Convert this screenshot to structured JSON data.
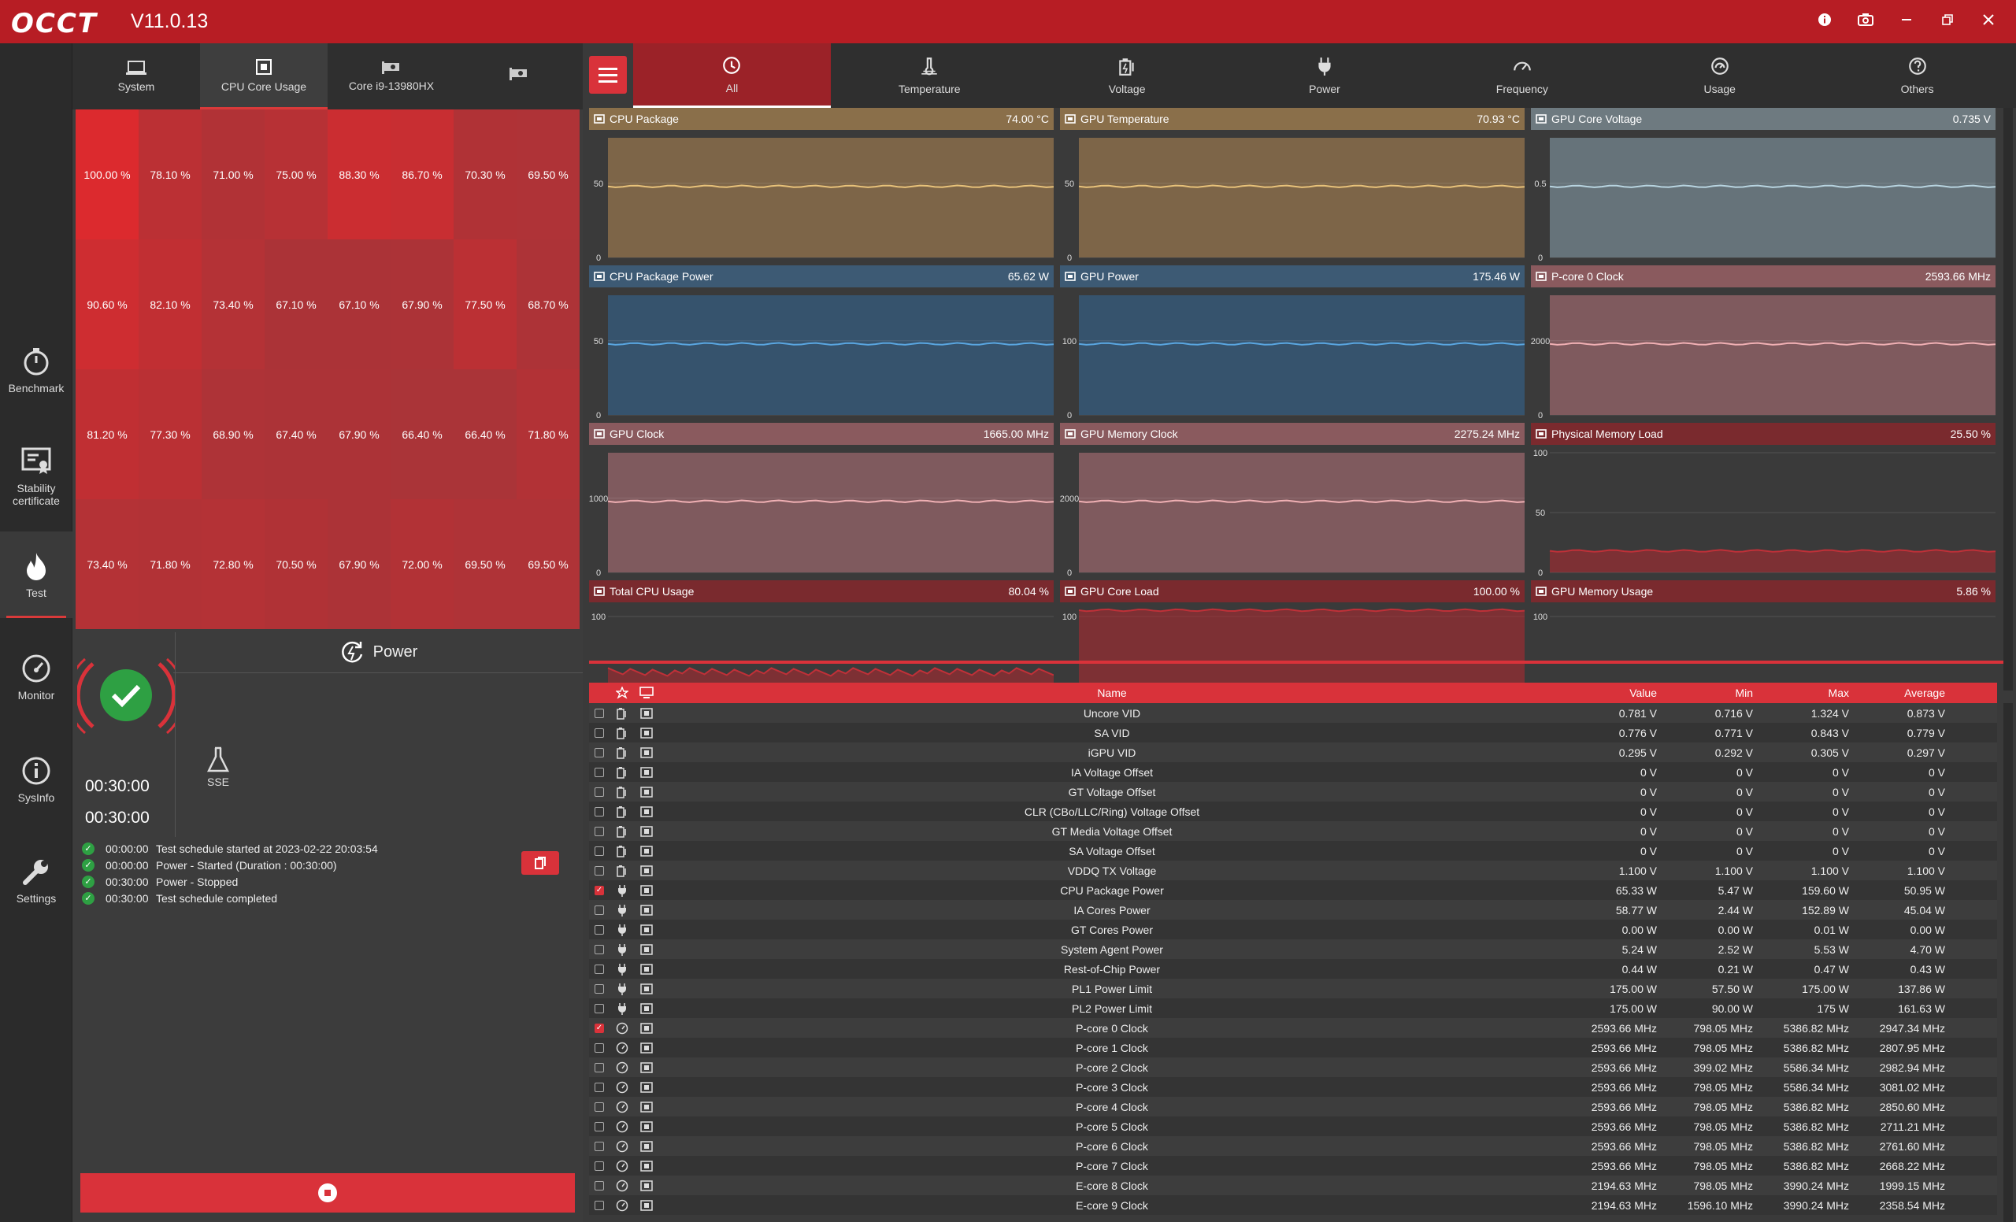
{
  "app": {
    "logo": "OCCT",
    "version": "V11.0.13"
  },
  "window_buttons": [
    "info-icon",
    "camera-icon",
    "minimize-icon",
    "restore-icon",
    "close-icon"
  ],
  "sidebar": [
    {
      "label": "Benchmark",
      "icon": "stopwatch-icon"
    },
    {
      "label": "Stability certificate",
      "icon": "certificate-icon"
    },
    {
      "label": "Test",
      "icon": "flame-icon",
      "active": true
    },
    {
      "label": "Monitor",
      "icon": "gauge-icon"
    },
    {
      "label": "SysInfo",
      "icon": "info-icon"
    },
    {
      "label": "Settings",
      "icon": "wrench-icon"
    }
  ],
  "left_tabs": [
    {
      "label": "System",
      "active": false
    },
    {
      "label": "CPU Core Usage",
      "active": true
    },
    {
      "label": "Core i9-13980HX",
      "active": false
    },
    {
      "label": "",
      "active": false
    }
  ],
  "core_usage": [
    "100.00 %",
    "78.10 %",
    "71.00 %",
    "75.00 %",
    "88.30 %",
    "86.70 %",
    "70.30 %",
    "69.50 %",
    "90.60 %",
    "82.10 %",
    "73.40 %",
    "67.10 %",
    "67.10 %",
    "67.90 %",
    "77.50 %",
    "68.70 %",
    "81.20 %",
    "77.30 %",
    "68.90 %",
    "67.40 %",
    "67.90 %",
    "66.40 %",
    "66.40 %",
    "71.80 %",
    "73.40 %",
    "71.80 %",
    "72.80 %",
    "70.50 %",
    "67.90 %",
    "72.00 %",
    "69.50 %",
    "69.50 %"
  ],
  "test": {
    "name": "Power",
    "elapsed": "00:30:00",
    "duration": "00:30:00",
    "mode": "SSE",
    "status": "completed"
  },
  "log": [
    {
      "time": "00:00:00",
      "text": "Test schedule started at 2023-02-22 20:03:54"
    },
    {
      "time": "00:00:00",
      "text": "Power - Started (Duration : 00:30:00)"
    },
    {
      "time": "00:30:00",
      "text": "Power - Stopped"
    },
    {
      "time": "00:30:00",
      "text": "Test schedule completed"
    }
  ],
  "right_tabs": [
    {
      "label": "All",
      "icon": "clock-icon",
      "active": true
    },
    {
      "label": "Temperature",
      "icon": "temperature-icon"
    },
    {
      "label": "Voltage",
      "icon": "battery-icon"
    },
    {
      "label": "Power",
      "icon": "plug-icon"
    },
    {
      "label": "Frequency",
      "icon": "speedometer-icon"
    },
    {
      "label": "Usage",
      "icon": "usage-gauge-icon"
    },
    {
      "label": "Others",
      "icon": "question-icon"
    }
  ],
  "charts": [
    {
      "title": "CPU Package",
      "value": "74.00 °C",
      "ticks": [
        "50",
        "0"
      ],
      "level": 0.66,
      "hdr": "#8a6f4a",
      "bg": "#7d6548",
      "line": "#e8c27a"
    },
    {
      "title": "GPU Temperature",
      "value": "70.93 °C",
      "ticks": [
        "50",
        "0"
      ],
      "level": 0.66,
      "hdr": "#8a6f4a",
      "bg": "#7d6548",
      "line": "#e8c27a"
    },
    {
      "title": "GPU Core Voltage",
      "value": "0.735 V",
      "ticks": [
        "0.5",
        "0"
      ],
      "level": 0.66,
      "hdr": "#6e7a80",
      "bg": "#66737a",
      "line": "#b8d4e0"
    },
    {
      "title": "CPU Package Power",
      "value": "65.62 W",
      "ticks": [
        "50",
        "0"
      ],
      "level": 0.66,
      "hdr": "#3d5a74",
      "bg": "#36536d",
      "line": "#5aa6e0"
    },
    {
      "title": "GPU Power",
      "value": "175.46 W",
      "ticks": [
        "100",
        "0"
      ],
      "level": 0.66,
      "hdr": "#3d5a74",
      "bg": "#36536d",
      "line": "#5aa6e0"
    },
    {
      "title": "P-core 0 Clock",
      "value": "2593.66 MHz",
      "ticks": [
        "2000",
        "0"
      ],
      "level": 0.66,
      "hdr": "#8a5a5e",
      "bg": "#7f5a5e",
      "line": "#f0b0b4"
    },
    {
      "title": "GPU Clock",
      "value": "1665.00 MHz",
      "ticks": [
        "1000",
        "0"
      ],
      "level": 0.66,
      "hdr": "#8a5a5e",
      "bg": "#7f5a5e",
      "line": "#f0b0b4"
    },
    {
      "title": "GPU Memory Clock",
      "value": "2275.24 MHz",
      "ticks": [
        "2000",
        "0"
      ],
      "level": 0.66,
      "hdr": "#8a5a5e",
      "bg": "#7f5a5e",
      "line": "#f0b0b4"
    },
    {
      "title": "Physical Memory Load",
      "value": "25.50 %",
      "ticks": [
        "100",
        "50",
        "0"
      ],
      "level": 0.2,
      "hdr": "#7a2a2e",
      "bg": "#3a3a3a",
      "line": "#c03038"
    },
    {
      "title": "Total CPU Usage",
      "value": "80.04 %",
      "ticks": [
        "100"
      ],
      "level": 0.3,
      "hdr": "#7a2a2e",
      "bg": "#3a3a3a",
      "line": "#c03038"
    },
    {
      "title": "GPU Core Load",
      "value": "100.00 %",
      "ticks": [
        "100"
      ],
      "level": 1.0,
      "hdr": "#7a2a2e",
      "bg": "#3a3a3a",
      "line": "#c03038"
    },
    {
      "title": "GPU Memory Usage",
      "value": "5.86 %",
      "ticks": [
        "100"
      ],
      "level": 0.06,
      "hdr": "#7a2a2e",
      "bg": "#3a3a3a",
      "line": "#c03038"
    }
  ],
  "table": {
    "headers": {
      "name": "Name",
      "value": "Value",
      "min": "Min",
      "max": "Max",
      "average": "Average"
    },
    "rows": [
      {
        "type": "voltage",
        "checked": false,
        "name": "Uncore VID",
        "value": "0.781 V",
        "min": "0.716 V",
        "max": "1.324 V",
        "avg": "0.873 V"
      },
      {
        "type": "voltage",
        "checked": false,
        "name": "SA VID",
        "value": "0.776 V",
        "min": "0.771 V",
        "max": "0.843 V",
        "avg": "0.779 V"
      },
      {
        "type": "voltage",
        "checked": false,
        "name": "iGPU VID",
        "value": "0.295 V",
        "min": "0.292 V",
        "max": "0.305 V",
        "avg": "0.297 V"
      },
      {
        "type": "voltage",
        "checked": false,
        "name": "IA Voltage Offset",
        "value": "0 V",
        "min": "0 V",
        "max": "0 V",
        "avg": "0 V"
      },
      {
        "type": "voltage",
        "checked": false,
        "name": "GT Voltage Offset",
        "value": "0 V",
        "min": "0 V",
        "max": "0 V",
        "avg": "0 V"
      },
      {
        "type": "voltage",
        "checked": false,
        "name": "CLR (CBo/LLC/Ring) Voltage Offset",
        "value": "0 V",
        "min": "0 V",
        "max": "0 V",
        "avg": "0 V"
      },
      {
        "type": "voltage",
        "checked": false,
        "name": "GT Media Voltage Offset",
        "value": "0 V",
        "min": "0 V",
        "max": "0 V",
        "avg": "0 V"
      },
      {
        "type": "voltage",
        "checked": false,
        "name": "SA Voltage Offset",
        "value": "0 V",
        "min": "0 V",
        "max": "0 V",
        "avg": "0 V"
      },
      {
        "type": "voltage",
        "checked": false,
        "name": "VDDQ TX Voltage",
        "value": "1.100 V",
        "min": "1.100 V",
        "max": "1.100 V",
        "avg": "1.100 V"
      },
      {
        "type": "power",
        "checked": true,
        "name": "CPU Package Power",
        "value": "65.33 W",
        "min": "5.47 W",
        "max": "159.60 W",
        "avg": "50.95 W"
      },
      {
        "type": "power",
        "checked": false,
        "name": "IA Cores Power",
        "value": "58.77 W",
        "min": "2.44 W",
        "max": "152.89 W",
        "avg": "45.04 W"
      },
      {
        "type": "power",
        "checked": false,
        "name": "GT Cores Power",
        "value": "0.00 W",
        "min": "0.00 W",
        "max": "0.01 W",
        "avg": "0.00 W"
      },
      {
        "type": "power",
        "checked": false,
        "name": "System Agent Power",
        "value": "5.24 W",
        "min": "2.52 W",
        "max": "5.53 W",
        "avg": "4.70 W"
      },
      {
        "type": "power",
        "checked": false,
        "name": "Rest-of-Chip Power",
        "value": "0.44 W",
        "min": "0.21 W",
        "max": "0.47 W",
        "avg": "0.43 W"
      },
      {
        "type": "power",
        "checked": false,
        "name": "PL1 Power Limit",
        "value": "175.00 W",
        "min": "57.50 W",
        "max": "175.00 W",
        "avg": "137.86 W"
      },
      {
        "type": "power",
        "checked": false,
        "name": "PL2 Power Limit",
        "value": "175.00 W",
        "min": "90.00 W",
        "max": "175 W",
        "avg": "161.63 W"
      },
      {
        "type": "freq",
        "checked": true,
        "name": "P-core 0 Clock",
        "value": "2593.66 MHz",
        "min": "798.05 MHz",
        "max": "5386.82 MHz",
        "avg": "2947.34 MHz"
      },
      {
        "type": "freq",
        "checked": false,
        "name": "P-core 1 Clock",
        "value": "2593.66 MHz",
        "min": "798.05 MHz",
        "max": "5386.82 MHz",
        "avg": "2807.95 MHz"
      },
      {
        "type": "freq",
        "checked": false,
        "name": "P-core 2 Clock",
        "value": "2593.66 MHz",
        "min": "399.02 MHz",
        "max": "5586.34 MHz",
        "avg": "2982.94 MHz"
      },
      {
        "type": "freq",
        "checked": false,
        "name": "P-core 3 Clock",
        "value": "2593.66 MHz",
        "min": "798.05 MHz",
        "max": "5586.34 MHz",
        "avg": "3081.02 MHz"
      },
      {
        "type": "freq",
        "checked": false,
        "name": "P-core 4 Clock",
        "value": "2593.66 MHz",
        "min": "798.05 MHz",
        "max": "5386.82 MHz",
        "avg": "2850.60 MHz"
      },
      {
        "type": "freq",
        "checked": false,
        "name": "P-core 5 Clock",
        "value": "2593.66 MHz",
        "min": "798.05 MHz",
        "max": "5386.82 MHz",
        "avg": "2711.21 MHz"
      },
      {
        "type": "freq",
        "checked": false,
        "name": "P-core 6 Clock",
        "value": "2593.66 MHz",
        "min": "798.05 MHz",
        "max": "5386.82 MHz",
        "avg": "2761.60 MHz"
      },
      {
        "type": "freq",
        "checked": false,
        "name": "P-core 7 Clock",
        "value": "2593.66 MHz",
        "min": "798.05 MHz",
        "max": "5386.82 MHz",
        "avg": "2668.22 MHz"
      },
      {
        "type": "freq",
        "checked": false,
        "name": "E-core 8 Clock",
        "value": "2194.63 MHz",
        "min": "798.05 MHz",
        "max": "3990.24 MHz",
        "avg": "1999.15 MHz"
      },
      {
        "type": "freq",
        "checked": false,
        "name": "E-core 9 Clock",
        "value": "2194.63 MHz",
        "min": "1596.10 MHz",
        "max": "3990.24 MHz",
        "avg": "2358.54 MHz"
      }
    ]
  }
}
